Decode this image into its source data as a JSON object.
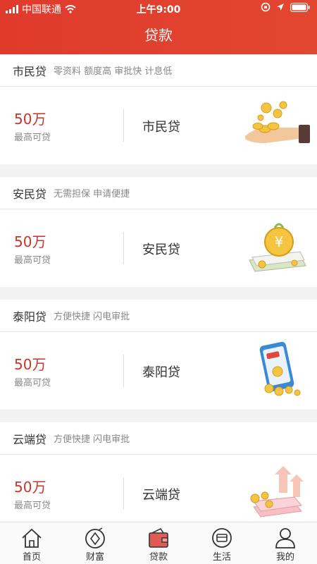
{
  "status_bar": {
    "carrier": "中国联通",
    "time": "上午9:00"
  },
  "header": {
    "title": "贷款"
  },
  "loans": [
    {
      "name": "市民贷",
      "tags": "零资料 额度高 审批快 计息低",
      "amount": "50万",
      "amount_label": "最高可贷",
      "product": "市民贷",
      "illustration": "hand-coins-icon"
    },
    {
      "name": "安民贷",
      "tags": "无需担保 申请便捷",
      "amount": "50万",
      "amount_label": "最高可贷",
      "product": "安民贷",
      "illustration": "money-bag-cash-icon"
    },
    {
      "name": "泰阳贷",
      "tags": "方便快捷 闪电审批",
      "amount": "50万",
      "amount_label": "最高可贷",
      "product": "泰阳贷",
      "illustration": "phone-coins-icon"
    },
    {
      "name": "云端贷",
      "tags": "方便快捷 闪电审批",
      "amount": "50万",
      "amount_label": "最高可贷",
      "product": "云端贷",
      "illustration": "cash-stack-arrows-icon"
    }
  ],
  "tabbar": [
    {
      "label": "首页",
      "icon": "home-icon"
    },
    {
      "label": "财富",
      "icon": "wealth-icon"
    },
    {
      "label": "贷款",
      "icon": "wallet-icon",
      "active": true
    },
    {
      "label": "生活",
      "icon": "life-icon"
    },
    {
      "label": "我的",
      "icon": "user-icon"
    }
  ],
  "colors": {
    "header": "#e03a2d",
    "amount": "#c8352b",
    "active_tab": "#e05b55"
  }
}
